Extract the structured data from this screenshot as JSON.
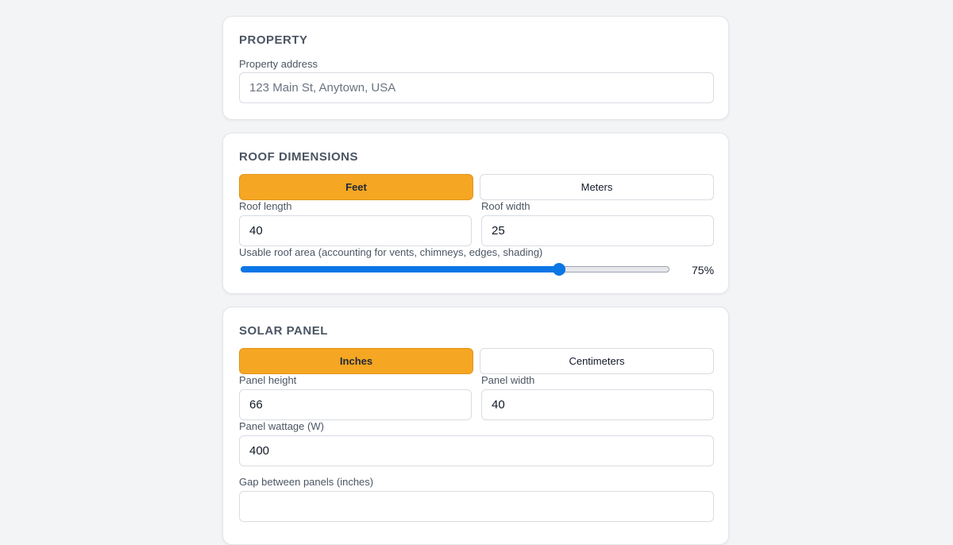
{
  "property": {
    "title": "PROPERTY",
    "address_label": "Property address",
    "address_placeholder": "123 Main St, Anytown, USA",
    "address_value": ""
  },
  "roof": {
    "title": "ROOF DIMENSIONS",
    "units": [
      "Feet",
      "Meters"
    ],
    "selected_unit": "Feet",
    "length_label": "Roof length",
    "length_value": "40",
    "width_label": "Roof width",
    "width_value": "25",
    "usable_label": "Usable roof area (accounting for vents, chimneys, edges, shading)",
    "usable_percent": 75,
    "usable_display": "75%"
  },
  "panel": {
    "title": "SOLAR PANEL",
    "units": [
      "Inches",
      "Centimeters"
    ],
    "selected_unit": "Inches",
    "height_label": "Panel height",
    "height_value": "66",
    "width_label": "Panel width",
    "width_value": "40",
    "wattage_label": "Panel wattage (W)",
    "wattage_value": "400",
    "gap_label": "Gap between panels (inches)",
    "gap_value": ""
  },
  "colors": {
    "accent": "#f5a623",
    "slider": "#0b76e5",
    "background": "#f3f4f6"
  }
}
